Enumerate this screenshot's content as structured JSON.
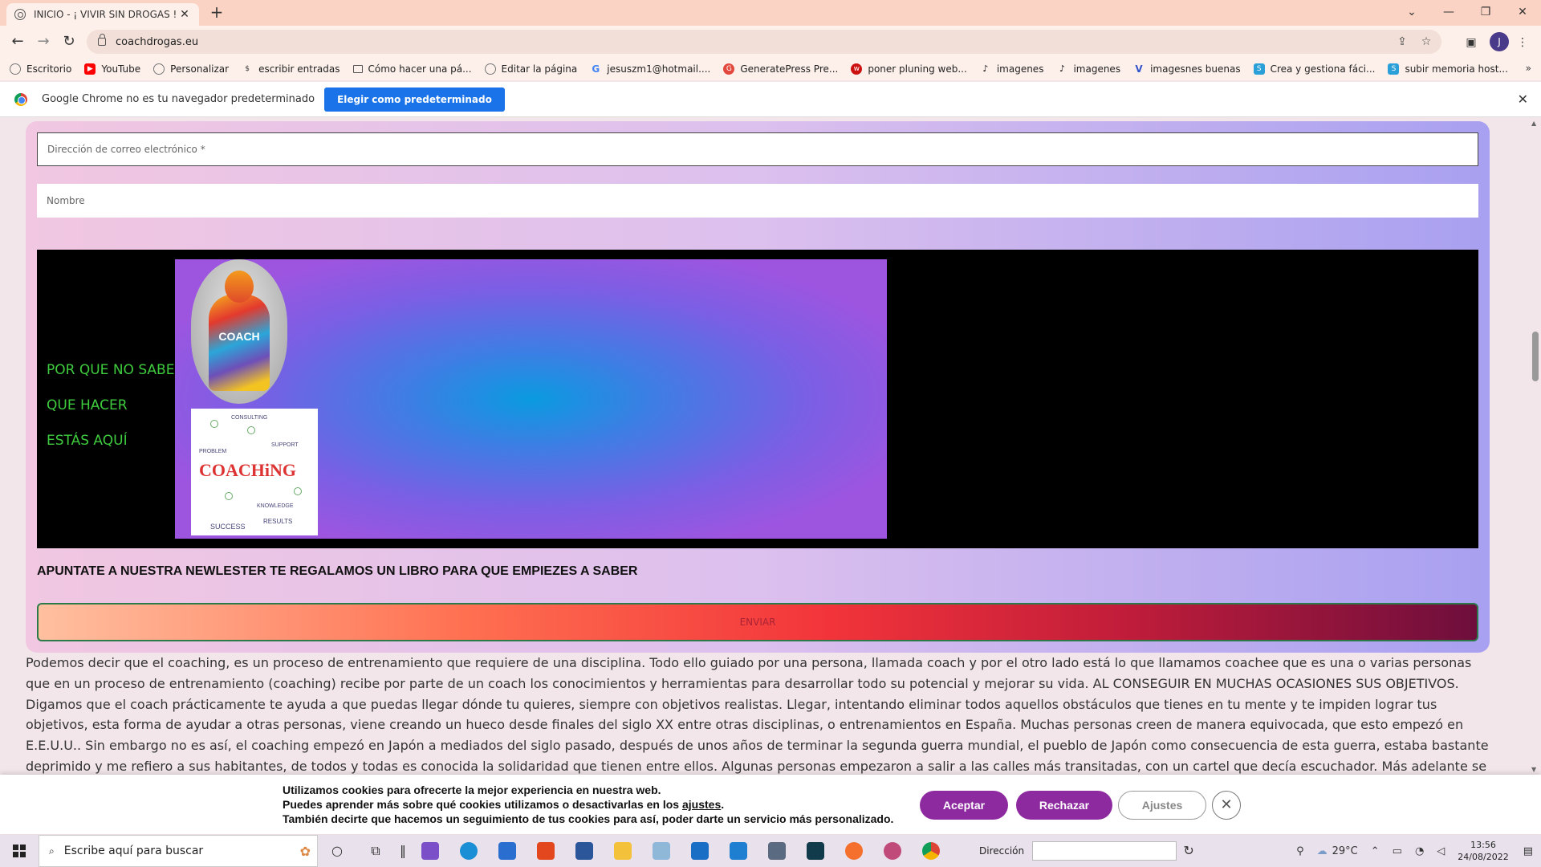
{
  "browser": {
    "tab_title": "INICIO - ¡ VIVIR SIN DROGAS !",
    "tab_close": "✕",
    "new_tab": "+",
    "url": "coachdrogas.eu",
    "profile_initial": "J",
    "bookmarks": [
      {
        "label": "Escritorio",
        "icon": "globe-icon",
        "color": "#777777"
      },
      {
        "label": "YouTube",
        "icon": "youtube-icon",
        "color": "#ff0000"
      },
      {
        "label": "Personalizar",
        "icon": "globe-icon",
        "color": "#777777"
      },
      {
        "label": "escribir entradas",
        "icon": "dollar-icon",
        "color": "#333333"
      },
      {
        "label": "Cómo hacer una pá...",
        "icon": "page-icon",
        "color": "#555555"
      },
      {
        "label": "Editar la página",
        "icon": "globe-icon",
        "color": "#777777"
      },
      {
        "label": "jesuszm1@hotmail....",
        "icon": "google-icon",
        "color": "#4285f4"
      },
      {
        "label": "GeneratePress Pre...",
        "icon": "generatepress-icon",
        "color": "#e2483d"
      },
      {
        "label": "poner pluning web...",
        "icon": "w-icon",
        "color": "#cc1111"
      },
      {
        "label": "imagenes",
        "icon": "tiktok-icon",
        "color": "#111111"
      },
      {
        "label": "imagenes",
        "icon": "tiktok-icon",
        "color": "#111111"
      },
      {
        "label": "imagesnes buenas",
        "icon": "v-icon",
        "color": "#3355cc"
      },
      {
        "label": "Crea y gestiona fáci...",
        "icon": "s-icon",
        "color": "#2b9fd8"
      },
      {
        "label": "subir memoria host...",
        "icon": "s-icon",
        "color": "#2b9fd8"
      }
    ],
    "bookmarks_more": "»"
  },
  "infobar": {
    "message": "Google Chrome no es tu navegador predeterminado",
    "button": "Elegir como predeterminado",
    "close": "✕"
  },
  "form": {
    "email_placeholder": "Dirección de correo electrónico *",
    "name_placeholder": "Nombre",
    "promo_lines": [
      "POR QUE NO SABES",
      "QUE HACER",
      "ESTÁS AQUÍ"
    ],
    "coach_label": "COACH",
    "coaching_image": {
      "title": "COACHiNG",
      "tags": [
        "CONSULTING",
        "PROBLEM",
        "SUPPORT",
        "KNOWLEDGE",
        "SUCCESS",
        "RESULTS"
      ]
    },
    "newsletter": "APUNTATE A NUESTRA NEWLESTER TE REGALAMOS UN LIBRO PARA QUE EMPIEZES A SABER",
    "submit": "ENVIAR"
  },
  "article": {
    "text": "Podemos decir que el coaching, es un proceso de entrenamiento que requiere de una disciplina. Todo ello guiado por una persona, llamada coach y por el otro lado está  lo que llamamos coachee que es una o varias personas que en un proceso de entrenamiento (coaching) recibe por parte de un coach los conocimientos y herramientas para desarrollar todo su potencial y mejorar su vida. AL CONSEGUIR EN MUCHAS OCASIONES SUS OBJETIVOS. Digamos que el coach prácticamente te ayuda a que puedas llegar dónde tu quieres, siempre con objetivos realistas. Llegar, intentando eliminar todos aquellos obstáculos que tienes en tu mente y te impiden lograr tus objetivos, esta forma de ayudar a otras personas, viene creando un hueco desde finales del siglo XX entre otras disciplinas, o entrenamientos en España. Muchas personas creen de manera equivocada, que esto empezó en E.E.U.U.. Sin embargo no es así, el coaching empezó en Japón a mediados del siglo pasado, después de unos años de terminar la segunda guerra mundial, el pueblo de Japón como consecuencia de esta guerra, estaba bastante deprimido y me refiero a sus habitantes, de todos y todas es conocida la solidaridad que tienen entre ellos. Algunas personas empezaron a salir a las calles más transitadas, con un cartel que decía escuchador. Más adelante se fundieron esta forma de ayudar con la filosofía de Sócrates. ¿Cómo?. De momento es un"
  },
  "cookie": {
    "line1": "Utilizamos cookies para ofrecerte la mejor experiencia en nuestra web.",
    "line2_prefix": "Puedes aprender más sobre qué cookies utilizamos o desactivarlas en los ",
    "line2_link": "ajustes",
    "line2_suffix": ".",
    "line3": "También decirte que hacemos un seguimiento de tus cookies para así, poder darte un servicio más personalizado.",
    "accept": "Aceptar",
    "reject": "Rechazar",
    "settings": "Ajustes",
    "close": "✕"
  },
  "taskbar": {
    "search_placeholder": "Escribe aquí para buscar",
    "address_label": "Dirección",
    "temperature": "29°C",
    "time": "13:56",
    "date": "24/08/2022"
  },
  "colors": {
    "accent_purple": "#8e2aa0",
    "chrome_blue": "#1a73e8",
    "promo_green": "#3ecb3e"
  }
}
